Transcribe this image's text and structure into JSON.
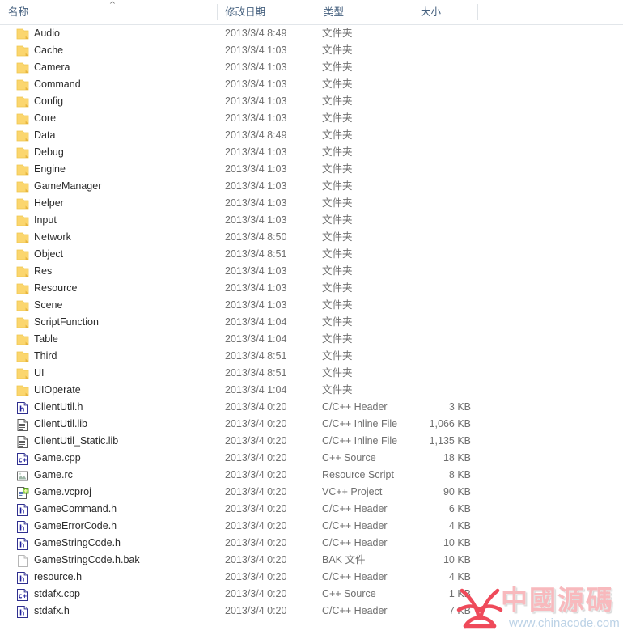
{
  "header": {
    "columns": [
      {
        "label": "名称",
        "key": "name"
      },
      {
        "label": "修改日期",
        "key": "date"
      },
      {
        "label": "类型",
        "key": "type"
      },
      {
        "label": "大小",
        "key": "size"
      }
    ],
    "sort_indicator": "^",
    "sort_column": "名称",
    "sort_direction": "ascending"
  },
  "colors": {
    "header_text": "#46617f",
    "row_text": "#2b2b2b",
    "meta_text": "#6f6f6f",
    "folder_icon": "#fbd66e",
    "header_divider": "#dfe3e7",
    "watermark_text": "#f8b9bd",
    "watermark_url": "#bcd2e6",
    "watermark_logo": "#ef4a5a"
  },
  "rows": [
    {
      "name": "Audio",
      "icon": "folder-icon",
      "date": "2013/3/4 8:49",
      "type": "文件夹",
      "size": ""
    },
    {
      "name": "Cache",
      "icon": "folder-icon",
      "date": "2013/3/4 1:03",
      "type": "文件夹",
      "size": ""
    },
    {
      "name": "Camera",
      "icon": "folder-icon",
      "date": "2013/3/4 1:03",
      "type": "文件夹",
      "size": ""
    },
    {
      "name": "Command",
      "icon": "folder-icon",
      "date": "2013/3/4 1:03",
      "type": "文件夹",
      "size": ""
    },
    {
      "name": "Config",
      "icon": "folder-icon",
      "date": "2013/3/4 1:03",
      "type": "文件夹",
      "size": ""
    },
    {
      "name": "Core",
      "icon": "folder-icon",
      "date": "2013/3/4 1:03",
      "type": "文件夹",
      "size": ""
    },
    {
      "name": "Data",
      "icon": "folder-icon",
      "date": "2013/3/4 8:49",
      "type": "文件夹",
      "size": ""
    },
    {
      "name": "Debug",
      "icon": "folder-icon",
      "date": "2013/3/4 1:03",
      "type": "文件夹",
      "size": ""
    },
    {
      "name": "Engine",
      "icon": "folder-icon",
      "date": "2013/3/4 1:03",
      "type": "文件夹",
      "size": ""
    },
    {
      "name": "GameManager",
      "icon": "folder-icon",
      "date": "2013/3/4 1:03",
      "type": "文件夹",
      "size": ""
    },
    {
      "name": "Helper",
      "icon": "folder-icon",
      "date": "2013/3/4 1:03",
      "type": "文件夹",
      "size": ""
    },
    {
      "name": "Input",
      "icon": "folder-icon",
      "date": "2013/3/4 1:03",
      "type": "文件夹",
      "size": ""
    },
    {
      "name": "Network",
      "icon": "folder-icon",
      "date": "2013/3/4 8:50",
      "type": "文件夹",
      "size": ""
    },
    {
      "name": "Object",
      "icon": "folder-icon",
      "date": "2013/3/4 8:51",
      "type": "文件夹",
      "size": ""
    },
    {
      "name": "Res",
      "icon": "folder-icon",
      "date": "2013/3/4 1:03",
      "type": "文件夹",
      "size": ""
    },
    {
      "name": "Resource",
      "icon": "folder-icon",
      "date": "2013/3/4 1:03",
      "type": "文件夹",
      "size": ""
    },
    {
      "name": "Scene",
      "icon": "folder-icon",
      "date": "2013/3/4 1:03",
      "type": "文件夹",
      "size": ""
    },
    {
      "name": "ScriptFunction",
      "icon": "folder-icon",
      "date": "2013/3/4 1:04",
      "type": "文件夹",
      "size": ""
    },
    {
      "name": "Table",
      "icon": "folder-icon",
      "date": "2013/3/4 1:04",
      "type": "文件夹",
      "size": ""
    },
    {
      "name": "Third",
      "icon": "folder-icon",
      "date": "2013/3/4 8:51",
      "type": "文件夹",
      "size": ""
    },
    {
      "name": "UI",
      "icon": "folder-icon",
      "date": "2013/3/4 8:51",
      "type": "文件夹",
      "size": ""
    },
    {
      "name": "UIOperate",
      "icon": "folder-icon",
      "date": "2013/3/4 1:04",
      "type": "文件夹",
      "size": ""
    },
    {
      "name": "ClientUtil.h",
      "icon": "header-file-icon",
      "date": "2013/3/4 0:20",
      "type": "C/C++ Header",
      "size": "3 KB"
    },
    {
      "name": "ClientUtil.lib",
      "icon": "generic-file-icon",
      "date": "2013/3/4 0:20",
      "type": "C/C++ Inline File",
      "size": "1,066 KB"
    },
    {
      "name": "ClientUtil_Static.lib",
      "icon": "generic-file-icon",
      "date": "2013/3/4 0:20",
      "type": "C/C++ Inline File",
      "size": "1,135 KB"
    },
    {
      "name": "Game.cpp",
      "icon": "cpp-source-icon",
      "date": "2013/3/4 0:20",
      "type": "C++ Source",
      "size": "18 KB"
    },
    {
      "name": "Game.rc",
      "icon": "resource-script-icon",
      "date": "2013/3/4 0:20",
      "type": "Resource Script",
      "size": "8 KB"
    },
    {
      "name": "Game.vcproj",
      "icon": "vcproject-icon",
      "date": "2013/3/4 0:20",
      "type": "VC++ Project",
      "size": "90 KB"
    },
    {
      "name": "GameCommand.h",
      "icon": "header-file-icon",
      "date": "2013/3/4 0:20",
      "type": "C/C++ Header",
      "size": "6 KB"
    },
    {
      "name": "GameErrorCode.h",
      "icon": "header-file-icon",
      "date": "2013/3/4 0:20",
      "type": "C/C++ Header",
      "size": "4 KB"
    },
    {
      "name": "GameStringCode.h",
      "icon": "header-file-icon",
      "date": "2013/3/4 0:20",
      "type": "C/C++ Header",
      "size": "10 KB"
    },
    {
      "name": "GameStringCode.h.bak",
      "icon": "blank-file-icon",
      "date": "2013/3/4 0:20",
      "type": "BAK 文件",
      "size": "10 KB"
    },
    {
      "name": "resource.h",
      "icon": "header-file-icon",
      "date": "2013/3/4 0:20",
      "type": "C/C++ Header",
      "size": "4 KB"
    },
    {
      "name": "stdafx.cpp",
      "icon": "cpp-source-icon",
      "date": "2013/3/4 0:20",
      "type": "C++ Source",
      "size": "1 KB"
    },
    {
      "name": "stdafx.h",
      "icon": "header-file-icon",
      "date": "2013/3/4 0:20",
      "type": "C/C++ Header",
      "size": "7 KB"
    }
  ],
  "watermark": {
    "title": "中國源碼",
    "url": "www.chinacode.com"
  }
}
